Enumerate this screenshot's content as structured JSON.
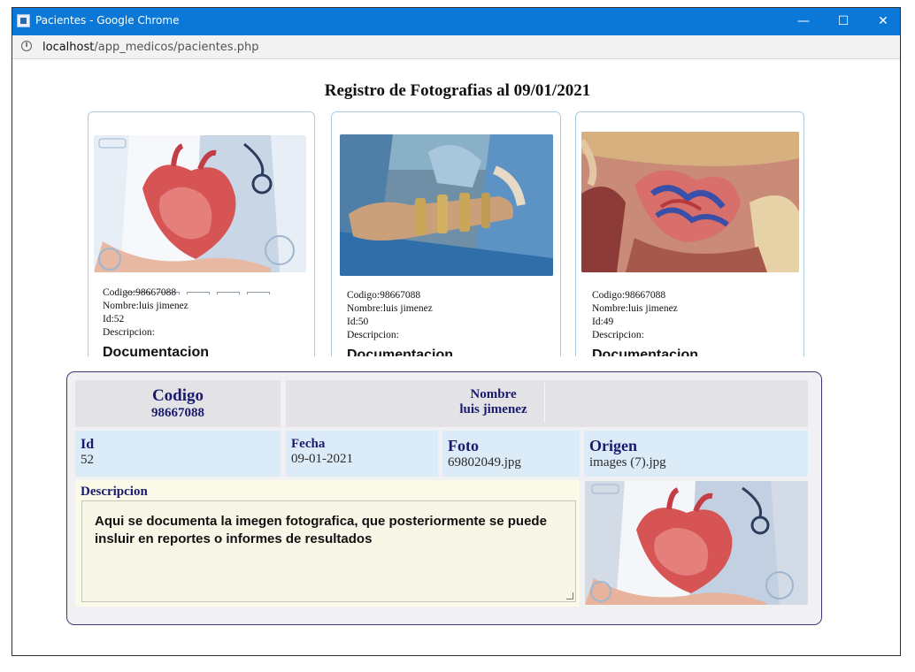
{
  "window": {
    "title": "Pacientes - Google Chrome",
    "minimize": "—",
    "maximize": "☐",
    "close": "✕"
  },
  "address": {
    "info": "i",
    "url_host": "localhost",
    "url_path": "/app_medicos/pacientes.php"
  },
  "page": {
    "title": "Registro de Fotografias al 09/01/2021"
  },
  "cards": [
    {
      "codigo_label": "Codigo:",
      "codigo": "98667088",
      "nombre_label": "Nombre:",
      "nombre": "luis jimenez",
      "id_label": "Id:",
      "id": "52",
      "descripcion_label": "Descripcion:",
      "doc": "Documentacion",
      "image": "heart-illustration"
    },
    {
      "codigo_label": "Codigo:",
      "codigo": "98667088",
      "nombre_label": "Nombre:",
      "nombre": "luis jimenez",
      "id_label": "Id:",
      "id": "50",
      "descripcion_label": "Descripcion:",
      "doc": "Documentacion",
      "image": "surgery-photo"
    },
    {
      "codigo_label": "Codigo:",
      "codigo": "98667088",
      "nombre_label": "Nombre:",
      "nombre": "luis jimenez",
      "id_label": "Id:",
      "id": "49",
      "descripcion_label": "Descripcion:",
      "doc": "Documentacion",
      "image": "anatomy-illustration"
    }
  ],
  "detail": {
    "codigo_label": "Codigo",
    "codigo": "98667088",
    "nombre_label": "Nombre",
    "nombre": "luis jimenez",
    "id_label": "Id",
    "id": "52",
    "fecha_label": "Fecha",
    "fecha": "09-01-2021",
    "foto_label": "Foto",
    "foto": "69802049.jpg",
    "origen_label": "Origen",
    "origen": "images (7).jpg",
    "descripcion_label": "Descripcion",
    "descripcion": "Aqui se documenta la imegen fotografica, que posteriormente se puede insluir en reportes o informes de resultados"
  },
  "colors": {
    "titlebar": "#0b78d7",
    "panel_border": "#39397a",
    "label_text": "#1a1a6e",
    "cell_blue": "#dcebf8",
    "desc_bg": "#f8f6e6"
  }
}
